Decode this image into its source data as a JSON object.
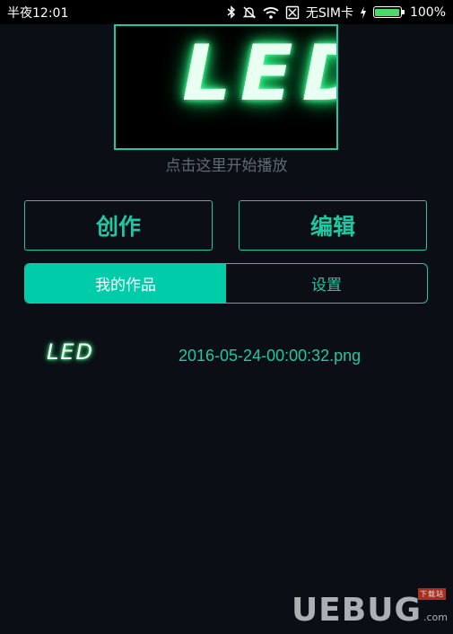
{
  "statusbar": {
    "time": "半夜12:01",
    "sim": "无SIM卡",
    "battery": "100%",
    "battery_level": 1.0,
    "icons": [
      "bluetooth-icon",
      "dnd-icon",
      "wifi-icon",
      "no-sim-icon",
      "charging-icon",
      "battery-icon"
    ]
  },
  "preview": {
    "text": "LED",
    "hint": "点击这里开始播放"
  },
  "buttons": {
    "create": "创作",
    "edit": "编辑"
  },
  "tabs": [
    {
      "label": "我的作品",
      "active": true
    },
    {
      "label": "设置",
      "active": false
    }
  ],
  "works": [
    {
      "thumb": "LED",
      "filename": "2016-05-24-00:00:32.png"
    }
  ],
  "watermark": {
    "logo": "UEBUG",
    "sub": "下载站",
    "url": ".com"
  },
  "colors": {
    "accent": "#1fc7a4",
    "tab_active_bg": "#00ccaa",
    "background": "#0b0e14",
    "led_glow": "#2dff85"
  }
}
